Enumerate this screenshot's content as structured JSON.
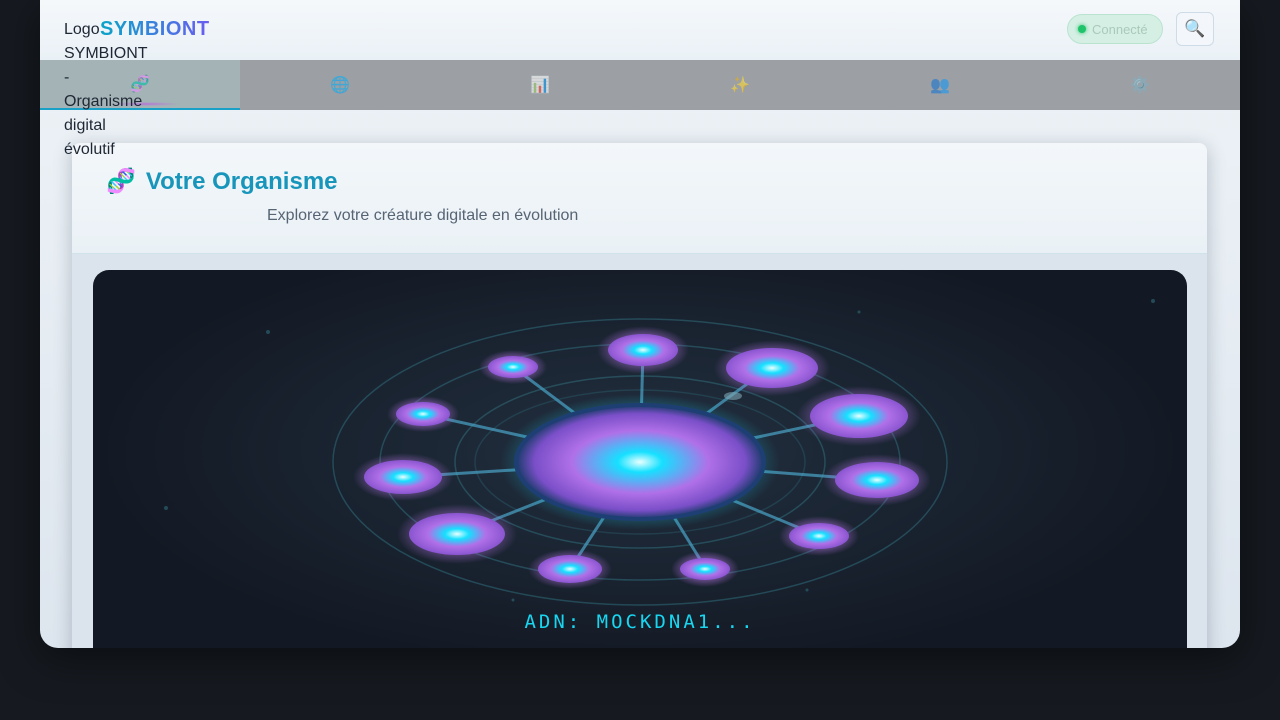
{
  "header": {
    "logo_alt": "Logo SYMBIONT - Organisme digital évolutif",
    "brand": "SYMBIONT",
    "status": "Connecté",
    "search_icon": "magnifier-icon"
  },
  "nav": {
    "items": [
      {
        "icon": "🧬",
        "name": "dna-icon"
      },
      {
        "icon": "🌐",
        "name": "globe-icon"
      },
      {
        "icon": "📊",
        "name": "bar-chart-icon"
      },
      {
        "icon": "✨",
        "name": "sparkles-icon"
      },
      {
        "icon": "👥",
        "name": "users-icon"
      },
      {
        "icon": "⚙️",
        "name": "gear-icon"
      }
    ]
  },
  "panel": {
    "icon": "🧬",
    "title": "Votre Organisme",
    "subtitle": "Explorez votre créature digitale en évolution"
  },
  "organism": {
    "dna_label": "ADN: MOCKDNA1...",
    "core_color": "#9a5ad8",
    "node_color": "#b06ae0",
    "glow_color": "#16e0ff"
  }
}
